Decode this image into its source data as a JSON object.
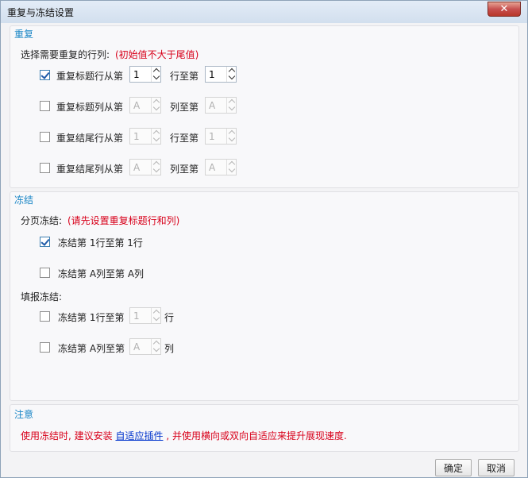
{
  "window": {
    "title": "重复与冻结设置",
    "close_label": "✕"
  },
  "repeat": {
    "title": "重复",
    "prompt": "选择需要重复的行列:",
    "hint": "(初始值不大于尾值)",
    "rows": [
      {
        "checked": true,
        "label": "重复标题行从第",
        "from": "1",
        "mid": "行至第",
        "to": "1",
        "enabled": true
      },
      {
        "checked": false,
        "label": "重复标题列从第",
        "from": "A",
        "mid": "列至第",
        "to": "A",
        "enabled": false
      },
      {
        "checked": false,
        "label": "重复结尾行从第",
        "from": "1",
        "mid": "行至第",
        "to": "1",
        "enabled": false
      },
      {
        "checked": false,
        "label": "重复结尾列从第",
        "from": "A",
        "mid": "列至第",
        "to": "A",
        "enabled": false
      }
    ]
  },
  "freeze": {
    "title": "冻结",
    "paging_label": "分页冻结:",
    "paging_hint": "(请先设置重复标题行和列)",
    "paging_rows": [
      {
        "checked": true,
        "label": "冻结第 1行至第 1行"
      },
      {
        "checked": false,
        "label": "冻结第 A列至第 A列"
      }
    ],
    "fill_label": "填报冻结:",
    "fill_rows": [
      {
        "checked": false,
        "label": "冻结第 1行至第",
        "value": "1",
        "suffix": "行"
      },
      {
        "checked": false,
        "label": "冻结第 A列至第",
        "value": "A",
        "suffix": "列"
      }
    ]
  },
  "note": {
    "title": "注意",
    "text_before": "使用冻结时, 建议安装",
    "link": "自适应插件",
    "text_after": ", 并使用横向或双向自适应来提升展现速度."
  },
  "buttons": {
    "ok": "确定",
    "cancel": "取消"
  }
}
